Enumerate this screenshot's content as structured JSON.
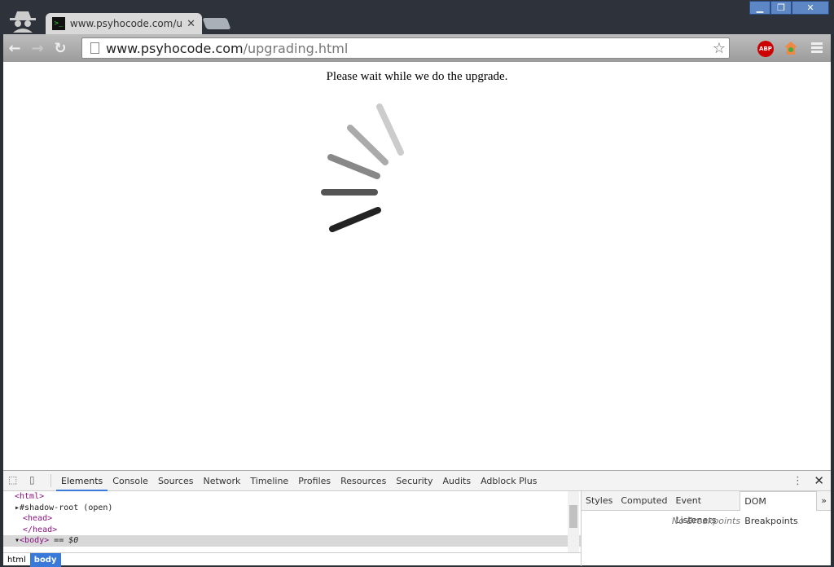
{
  "browser": {
    "tab_title": "www.psyhocode.com/upgrading.html",
    "url_host": "www.psyhocode.com",
    "url_path": "/upgrading.html",
    "extension_abp": "ABP"
  },
  "page": {
    "message": "Please wait while we do the upgrade.",
    "spinner_colors": [
      "#cccccc",
      "#aaaaaa",
      "#888888",
      "#555555",
      "#222222"
    ]
  },
  "devtools": {
    "tabs": [
      "Elements",
      "Console",
      "Sources",
      "Network",
      "Timeline",
      "Profiles",
      "Resources",
      "Security",
      "Audits",
      "Adblock Plus"
    ],
    "dom": [
      "<html>",
      "#shadow-root (open)",
      "<head>",
      "</head>",
      "<body>",
      " == $0"
    ],
    "breadcrumbs": [
      "html",
      "body"
    ],
    "side_tabs": [
      "Styles",
      "Computed",
      "Event Listeners",
      "DOM Breakpoints"
    ],
    "side_more": "»",
    "no_breakpoints": "No Breakpoints"
  }
}
